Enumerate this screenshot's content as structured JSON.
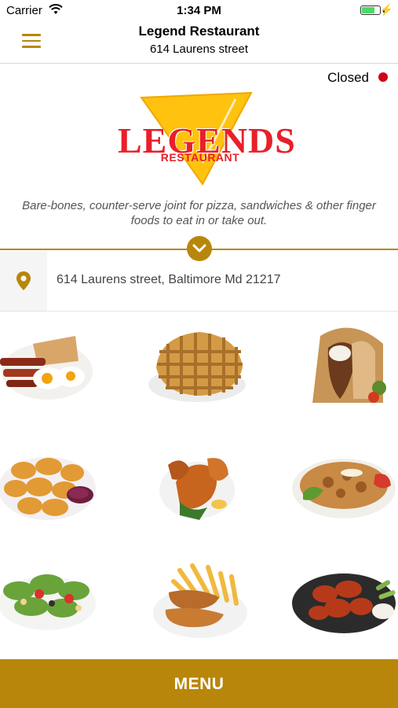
{
  "status_bar": {
    "carrier": "Carrier",
    "time": "1:34 PM"
  },
  "header": {
    "title": "Legend Restaurant",
    "subtitle": "614 Laurens street"
  },
  "restaurant": {
    "open_status": "Closed",
    "status_color": "#d0021b",
    "logo_text": "LEGENDS",
    "logo_subtext": "RESTAURANT",
    "description": "Bare-bones, counter-serve joint for pizza, sandwiches & other finger foods to eat in or take out.",
    "address": "614 Laurens street, Baltimore Md 21217"
  },
  "gallery": {
    "items": [
      {
        "name": "breakfast-plate"
      },
      {
        "name": "waffles"
      },
      {
        "name": "gyro-wrap"
      },
      {
        "name": "chicken-nuggets"
      },
      {
        "name": "fried-chicken"
      },
      {
        "name": "chicken-over-rice"
      },
      {
        "name": "garden-salad"
      },
      {
        "name": "chicken-tenders-fries"
      },
      {
        "name": "buffalo-wings"
      }
    ]
  },
  "footer": {
    "menu_label": "MENU"
  },
  "colors": {
    "accent": "#b8860b",
    "logo_red": "#e8202a",
    "logo_yellow": "#ffc20e"
  }
}
